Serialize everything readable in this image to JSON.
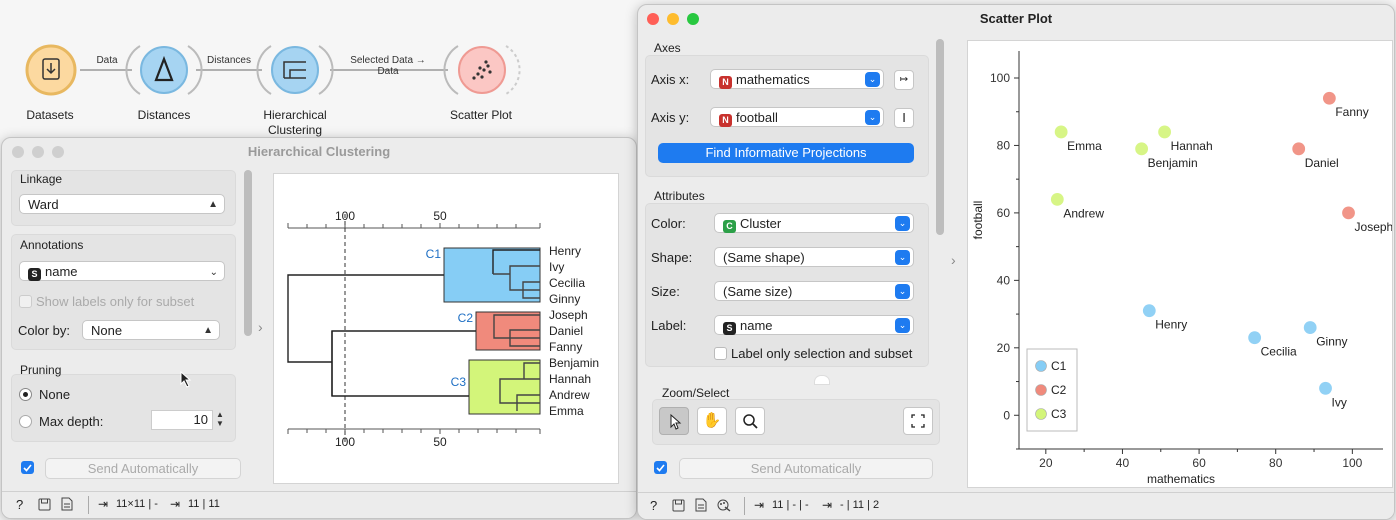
{
  "workflow": {
    "nodes": [
      {
        "label": "Datasets",
        "icon": "download-icon"
      },
      {
        "label": "Distances",
        "icon": "delta-icon"
      },
      {
        "label": "Hierarchical Clustering",
        "icon": "dendrogram-icon"
      },
      {
        "label": "Scatter Plot",
        "icon": "scatter-icon"
      }
    ],
    "links": [
      "Data",
      "Distances",
      "Selected Data → Data"
    ]
  },
  "hc": {
    "title": "Hierarchical Clustering",
    "linkage_label": "Linkage",
    "linkage_value": "Ward",
    "annotations_label": "Annotations",
    "annotations_value": "name",
    "show_labels_subset": "Show labels only for subset",
    "color_by_label": "Color by:",
    "color_by_value": "None",
    "pruning_label": "Pruning",
    "pruning_none": "None",
    "pruning_max_depth": "Max depth:",
    "max_depth_value": "10",
    "send_auto": "Send Automatically",
    "status_in": "11×11 | -",
    "status_out": "11 | 11",
    "axis_ticks": [
      "100",
      "50"
    ],
    "clusters": [
      {
        "name": "C1",
        "color": "#86cdf5",
        "members": [
          "Henry",
          "Ivy",
          "Cecilia",
          "Ginny"
        ]
      },
      {
        "name": "C2",
        "color": "#f08a7c",
        "members": [
          "Joseph",
          "Daniel",
          "Fanny"
        ]
      },
      {
        "name": "C3",
        "color": "#d3f57a",
        "members": [
          "Benjamin",
          "Hannah",
          "Andrew",
          "Emma"
        ]
      }
    ]
  },
  "sp": {
    "title": "Scatter Plot",
    "axes_label": "Axes",
    "axis_x_label": "Axis x:",
    "axis_x_value": "mathematics",
    "axis_y_label": "Axis y:",
    "axis_y_value": "football",
    "find_projections": "Find Informative Projections",
    "attributes_label": "Attributes",
    "color_label": "Color:",
    "color_value": "Cluster",
    "shape_label": "Shape:",
    "shape_value": "(Same shape)",
    "size_label": "Size:",
    "size_value": "(Same size)",
    "label_label": "Label:",
    "label_value": "name",
    "label_only_subset": "Label only selection and subset",
    "zoom_select_label": "Zoom/Select",
    "send_auto": "Send Automatically",
    "status_in": "11 | - | -",
    "status_out": "- | 11 | 2"
  },
  "chart_data": {
    "type": "scatter",
    "xlabel": "mathematics",
    "ylabel": "football",
    "xlim": [
      13,
      108
    ],
    "ylim": [
      -10,
      108
    ],
    "xticks": [
      20,
      40,
      60,
      80,
      100
    ],
    "yticks": [
      0,
      20,
      40,
      60,
      80,
      100
    ],
    "legend_position": "bottom-left",
    "series": [
      {
        "name": "C1",
        "color": "#86cdf5",
        "points": [
          {
            "label": "Henry",
            "x": 47,
            "y": 31
          },
          {
            "label": "Cecilia",
            "x": 74.5,
            "y": 23
          },
          {
            "label": "Ginny",
            "x": 89,
            "y": 26
          },
          {
            "label": "Ivy",
            "x": 93,
            "y": 8
          }
        ]
      },
      {
        "name": "C2",
        "color": "#f08a7c",
        "points": [
          {
            "label": "Fanny",
            "x": 94,
            "y": 94
          },
          {
            "label": "Daniel",
            "x": 86,
            "y": 79
          },
          {
            "label": "Joseph",
            "x": 99,
            "y": 60
          }
        ]
      },
      {
        "name": "C3",
        "color": "#d3f57a",
        "points": [
          {
            "label": "Emma",
            "x": 24,
            "y": 84
          },
          {
            "label": "Benjamin",
            "x": 45,
            "y": 79
          },
          {
            "label": "Hannah",
            "x": 51,
            "y": 84
          },
          {
            "label": "Andrew",
            "x": 23,
            "y": 64
          }
        ]
      }
    ]
  }
}
